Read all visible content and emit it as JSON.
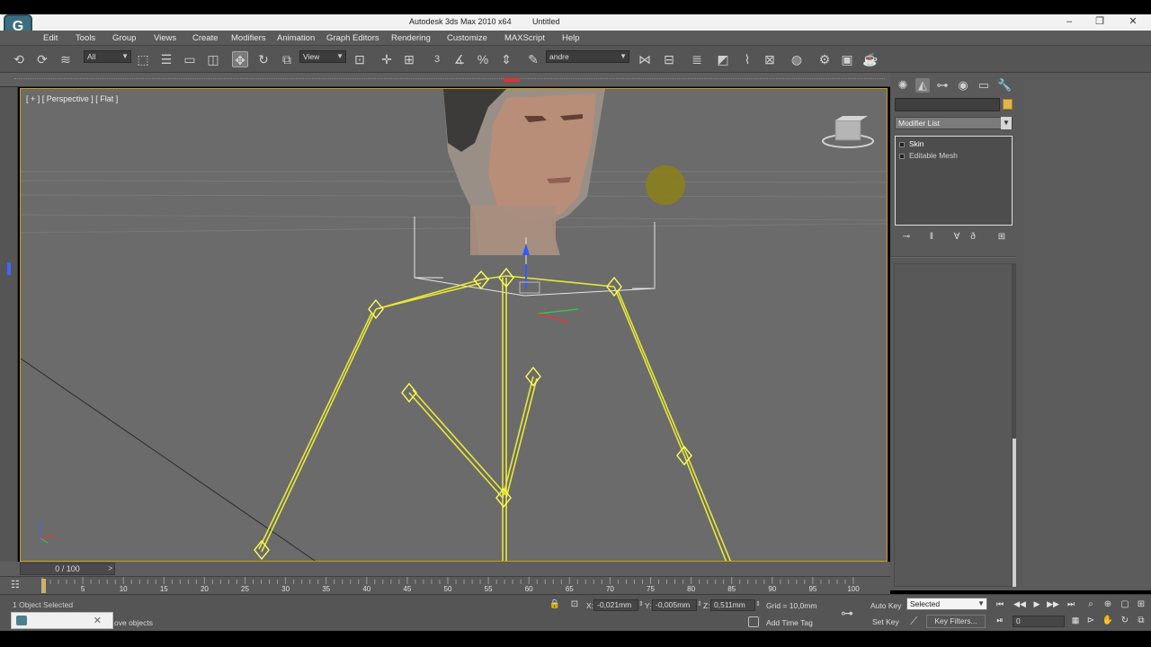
{
  "window": {
    "title": "Autodesk 3ds Max  2010 x64",
    "document": "Untitled",
    "logo": "G",
    "controls": {
      "minimize": "–",
      "restore": "❐",
      "close": "✕"
    }
  },
  "menu": [
    "Edit",
    "Tools",
    "Group",
    "Views",
    "Create",
    "Modifiers",
    "Animation",
    "Graph Editors",
    "Rendering",
    "Customize",
    "MAXScript",
    "Help"
  ],
  "toolbar": {
    "selection_filter": "All",
    "reference_coord": "View",
    "named_selection": "andre",
    "snap_value": "3"
  },
  "viewport": {
    "label": "[ + ] [ Perspective ] [ Flat ]"
  },
  "command_panel": {
    "object_name": "",
    "object_color": "#e0b64a",
    "modifier_list_label": "Modifier List",
    "stack": [
      {
        "label": "Skin",
        "selected": true
      },
      {
        "label": "Editable Mesh",
        "selected": false
      }
    ]
  },
  "timeline": {
    "frame_display": "0 / 100",
    "next_label": ">",
    "frame_labels": [
      "5",
      "10",
      "15",
      "20",
      "25",
      "30",
      "35",
      "40",
      "45",
      "50",
      "55",
      "60",
      "65",
      "70",
      "75",
      "80",
      "85",
      "90",
      "95",
      "100"
    ],
    "current_frame": 0,
    "total_frames": 100
  },
  "status": {
    "selection_info": "1 Object Selected",
    "prompt": "ove objects",
    "x_label": "X:",
    "x_value": "-0,021mm",
    "y_label": "Y:",
    "y_value": "-0,005mm",
    "z_label": "Z:",
    "z_value": "0,511mm",
    "grid": "Grid = 10,0mm",
    "add_time_tag": "Add Time Tag"
  },
  "animation": {
    "auto_key": "Auto Key",
    "set_key": "Set Key",
    "selected_dropdown": "Selected",
    "key_filters": "Key Filters...",
    "current_frame_field": "0"
  }
}
